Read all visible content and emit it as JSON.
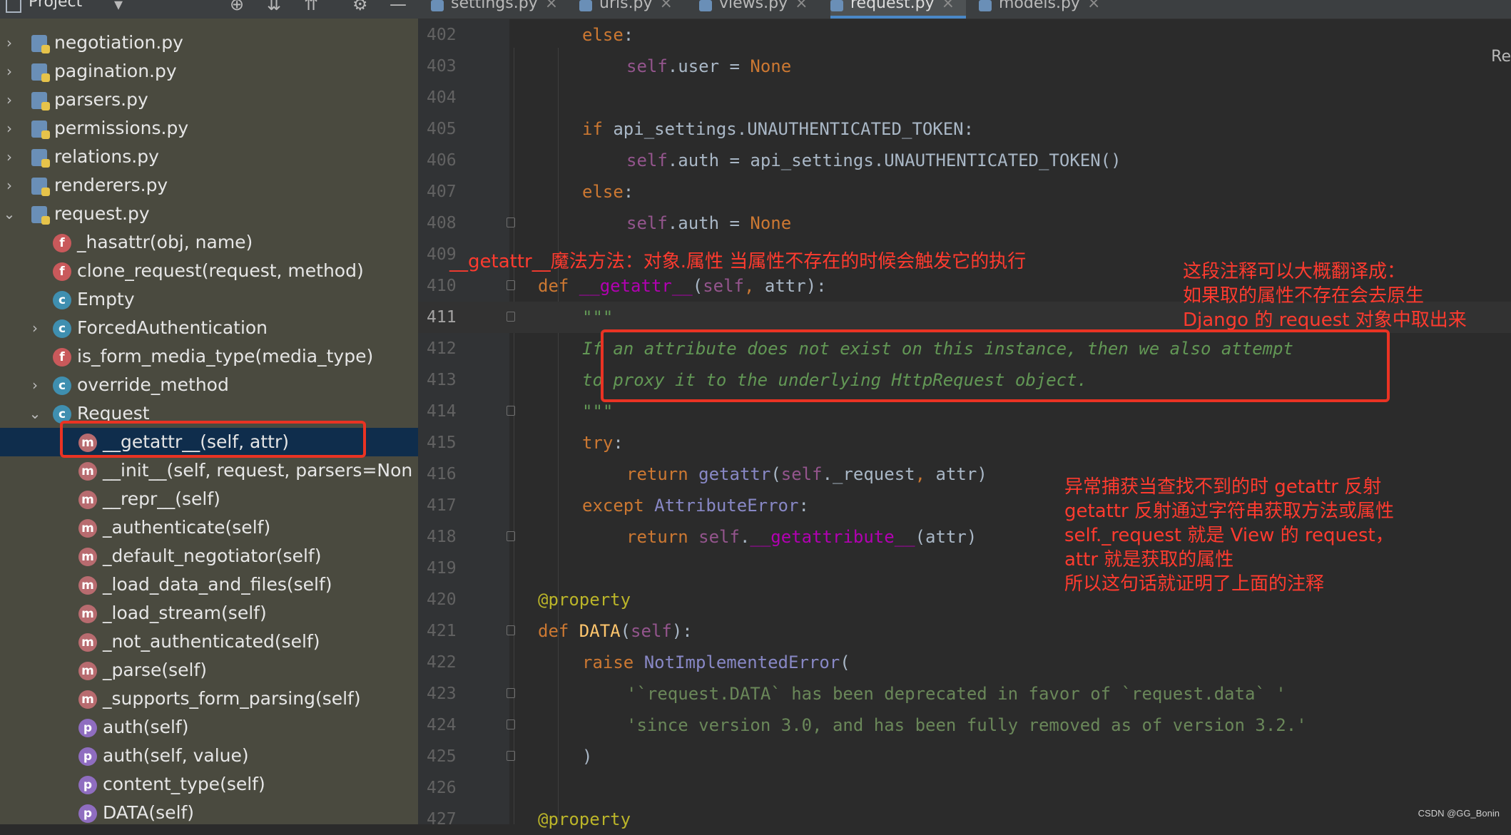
{
  "sidebar": {
    "title": "Project",
    "items": [
      {
        "label": "negotiation.py",
        "kind": "file",
        "indent": 0,
        "chevron": "right"
      },
      {
        "label": "pagination.py",
        "kind": "file",
        "indent": 0,
        "chevron": "right"
      },
      {
        "label": "parsers.py",
        "kind": "file",
        "indent": 0,
        "chevron": "right"
      },
      {
        "label": "permissions.py",
        "kind": "file",
        "indent": 0,
        "chevron": "right"
      },
      {
        "label": "relations.py",
        "kind": "file",
        "indent": 0,
        "chevron": "right"
      },
      {
        "label": "renderers.py",
        "kind": "file",
        "indent": 0,
        "chevron": "right"
      },
      {
        "label": "request.py",
        "kind": "file",
        "indent": 0,
        "chevron": "down"
      },
      {
        "label": "_hasattr(obj, name)",
        "kind": "f",
        "indent": 1,
        "chevron": ""
      },
      {
        "label": "clone_request(request, method)",
        "kind": "f",
        "indent": 1,
        "chevron": ""
      },
      {
        "label": "Empty",
        "kind": "c",
        "indent": 1,
        "chevron": ""
      },
      {
        "label": "ForcedAuthentication",
        "kind": "c",
        "indent": 1,
        "chevron": "right"
      },
      {
        "label": "is_form_media_type(media_type)",
        "kind": "f",
        "indent": 1,
        "chevron": ""
      },
      {
        "label": "override_method",
        "kind": "c",
        "indent": 1,
        "chevron": "right"
      },
      {
        "label": "Request",
        "kind": "c",
        "indent": 1,
        "chevron": "down"
      },
      {
        "label": "__getattr__(self, attr)",
        "kind": "m",
        "indent": 2,
        "chevron": "",
        "selected": true
      },
      {
        "label": "__init__(self, request, parsers=Non",
        "kind": "m",
        "indent": 2,
        "chevron": ""
      },
      {
        "label": "__repr__(self)",
        "kind": "m",
        "indent": 2,
        "chevron": ""
      },
      {
        "label": "_authenticate(self)",
        "kind": "m",
        "indent": 2,
        "chevron": ""
      },
      {
        "label": "_default_negotiator(self)",
        "kind": "m",
        "indent": 2,
        "chevron": ""
      },
      {
        "label": "_load_data_and_files(self)",
        "kind": "m",
        "indent": 2,
        "chevron": ""
      },
      {
        "label": "_load_stream(self)",
        "kind": "m",
        "indent": 2,
        "chevron": ""
      },
      {
        "label": "_not_authenticated(self)",
        "kind": "m",
        "indent": 2,
        "chevron": ""
      },
      {
        "label": "_parse(self)",
        "kind": "m",
        "indent": 2,
        "chevron": ""
      },
      {
        "label": "_supports_form_parsing(self)",
        "kind": "m",
        "indent": 2,
        "chevron": ""
      },
      {
        "label": "auth(self)",
        "kind": "p",
        "indent": 2,
        "chevron": ""
      },
      {
        "label": "auth(self, value)",
        "kind": "p",
        "indent": 2,
        "chevron": ""
      },
      {
        "label": "content_type(self)",
        "kind": "p",
        "indent": 2,
        "chevron": ""
      },
      {
        "label": "DATA(self)",
        "kind": "p",
        "indent": 2,
        "chevron": ""
      }
    ]
  },
  "tabs": [
    {
      "label": "settings.py",
      "active": false
    },
    {
      "label": "urls.py",
      "active": false
    },
    {
      "label": "views.py",
      "active": false
    },
    {
      "label": "request.py",
      "active": true
    },
    {
      "label": "models.py",
      "active": false
    }
  ],
  "editor": {
    "right_edge_text": "Re",
    "current_line": "411",
    "lines": [
      {
        "n": "402",
        "tokens": [
          [
            "kw",
            "else"
          ],
          [
            "tx",
            ":"
          ]
        ],
        "indent": 2
      },
      {
        "n": "403",
        "tokens": [
          [
            "slf",
            "self"
          ],
          [
            "tx",
            ".user = "
          ],
          [
            "none",
            "None"
          ]
        ],
        "indent": 3
      },
      {
        "n": "404",
        "tokens": [],
        "indent": 0
      },
      {
        "n": "405",
        "tokens": [
          [
            "kw",
            "if "
          ],
          [
            "tx",
            "api_settings.UNAUTHENTICATED_TOKEN:"
          ]
        ],
        "indent": 2
      },
      {
        "n": "406",
        "tokens": [
          [
            "slf",
            "self"
          ],
          [
            "tx",
            ".auth = api_settings.UNAUTHENTICATED_TOKEN()"
          ]
        ],
        "indent": 3
      },
      {
        "n": "407",
        "tokens": [
          [
            "kw",
            "else"
          ],
          [
            "tx",
            ":"
          ]
        ],
        "indent": 2
      },
      {
        "n": "408",
        "tokens": [
          [
            "slf",
            "self"
          ],
          [
            "tx",
            ".auth = "
          ],
          [
            "none",
            "None"
          ]
        ],
        "indent": 3
      },
      {
        "n": "409",
        "tokens": [],
        "indent": 0
      },
      {
        "n": "410",
        "tokens": [
          [
            "kw",
            "def "
          ],
          [
            "mg",
            "__getattr__"
          ],
          [
            "tx",
            "("
          ],
          [
            "slf",
            "self"
          ],
          [
            "kw",
            ", "
          ],
          [
            "tx",
            "attr):"
          ]
        ],
        "indent": 1
      },
      {
        "n": "411",
        "tokens": [
          [
            "doc",
            "\"\"\""
          ]
        ],
        "indent": 2
      },
      {
        "n": "412",
        "tokens": [
          [
            "doc",
            "If an attribute does not exist on this instance, then we also attempt"
          ]
        ],
        "indent": 2
      },
      {
        "n": "413",
        "tokens": [
          [
            "doc",
            "to proxy it to the underlying HttpRequest object."
          ]
        ],
        "indent": 2
      },
      {
        "n": "414",
        "tokens": [
          [
            "doc",
            "\"\"\""
          ]
        ],
        "indent": 2
      },
      {
        "n": "415",
        "tokens": [
          [
            "kw",
            "try"
          ],
          [
            "tx",
            ":"
          ]
        ],
        "indent": 2
      },
      {
        "n": "416",
        "tokens": [
          [
            "kw",
            "return "
          ],
          [
            "bi",
            "getattr"
          ],
          [
            "tx",
            "("
          ],
          [
            "slf",
            "self"
          ],
          [
            "tx",
            "._request"
          ],
          [
            "kw",
            ", "
          ],
          [
            "tx",
            "attr)"
          ]
        ],
        "indent": 3
      },
      {
        "n": "417",
        "tokens": [
          [
            "kw",
            "except "
          ],
          [
            "bi",
            "AttributeError"
          ],
          [
            "tx",
            ":"
          ]
        ],
        "indent": 2
      },
      {
        "n": "418",
        "tokens": [
          [
            "kw",
            "return "
          ],
          [
            "slf",
            "self"
          ],
          [
            "tx",
            "."
          ],
          [
            "mg",
            "__getattribute__"
          ],
          [
            "tx",
            "(attr)"
          ]
        ],
        "indent": 3
      },
      {
        "n": "419",
        "tokens": [],
        "indent": 0
      },
      {
        "n": "420",
        "tokens": [
          [
            "deco",
            "@property"
          ]
        ],
        "indent": 1
      },
      {
        "n": "421",
        "tokens": [
          [
            "kw",
            "def "
          ],
          [
            "fn",
            "DATA"
          ],
          [
            "tx",
            "("
          ],
          [
            "slf",
            "self"
          ],
          [
            "tx",
            "):"
          ]
        ],
        "indent": 1
      },
      {
        "n": "422",
        "tokens": [
          [
            "kw",
            "raise "
          ],
          [
            "bi",
            "NotImplementedError"
          ],
          [
            "tx",
            "("
          ]
        ],
        "indent": 2
      },
      {
        "n": "423",
        "tokens": [
          [
            "str",
            "'`request.DATA` has been deprecated in favor of `request.data` '"
          ]
        ],
        "indent": 3
      },
      {
        "n": "424",
        "tokens": [
          [
            "str",
            "'since version 3.0, and has been fully removed as of version 3.2.'"
          ]
        ],
        "indent": 3
      },
      {
        "n": "425",
        "tokens": [
          [
            "tx",
            ")"
          ]
        ],
        "indent": 2
      },
      {
        "n": "426",
        "tokens": [],
        "indent": 0
      },
      {
        "n": "427",
        "tokens": [
          [
            "deco",
            "@property"
          ]
        ],
        "indent": 1
      }
    ]
  },
  "annotations": {
    "getattr_title": "__getattr__魔法方法：对象.属性 当属性不存在的时候会触发它的执行",
    "translation_lines": [
      "这段注释可以大概翻译成：",
      "如果取的属性不存在会去原生",
      "Django 的 request 对象中取出来"
    ],
    "except_lines": [
      "异常捕获当查找不到的时 getattr 反射",
      "getattr 反射通过字符串获取方法或属性",
      "self._request 就是 View 的 request，",
      "attr 就是获取的属性",
      "所以这句话就证明了上面的注释"
    ]
  },
  "watermark": "CSDN @GG_Bonin",
  "colors": {
    "annotation_red": "#ff3b2f",
    "sidebar_bg": "#4a4a3f",
    "selection_bg": "#0f2d4c",
    "editor_bg": "#2b2b2b"
  }
}
